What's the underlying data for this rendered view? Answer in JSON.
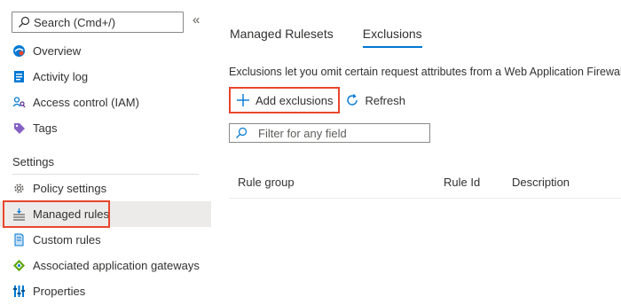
{
  "sidebar": {
    "search_placeholder": "Search (Cmd+/)",
    "collapse_label": "«",
    "items_top": [
      {
        "label": "Overview",
        "icon": "overview-icon"
      },
      {
        "label": "Activity log",
        "icon": "activity-log-icon"
      },
      {
        "label": "Access control (IAM)",
        "icon": "access-control-icon"
      },
      {
        "label": "Tags",
        "icon": "tag-icon"
      }
    ],
    "section_label": "Settings",
    "items_settings": [
      {
        "label": "Policy settings",
        "icon": "gear-icon"
      },
      {
        "label": "Managed rules",
        "icon": "managed-rules-icon",
        "selected": true
      },
      {
        "label": "Custom rules",
        "icon": "custom-rules-icon"
      },
      {
        "label": "Associated application gateways",
        "icon": "gateway-icon"
      },
      {
        "label": "Properties",
        "icon": "properties-icon"
      }
    ]
  },
  "main": {
    "tabs": [
      {
        "label": "Managed Rulesets",
        "active": false
      },
      {
        "label": "Exclusions",
        "active": true
      }
    ],
    "description": "Exclusions let you omit certain request attributes from a Web Application Firewall eva",
    "toolbar": {
      "add_label": "Add exclusions",
      "refresh_label": "Refresh"
    },
    "filter_placeholder": "Filter for any field",
    "table": {
      "columns": [
        "Rule group",
        "Rule Id",
        "Description"
      ]
    }
  },
  "colors": {
    "accent": "#0078d4",
    "highlight": "#e8462d",
    "selected_bg": "#edebe9"
  }
}
